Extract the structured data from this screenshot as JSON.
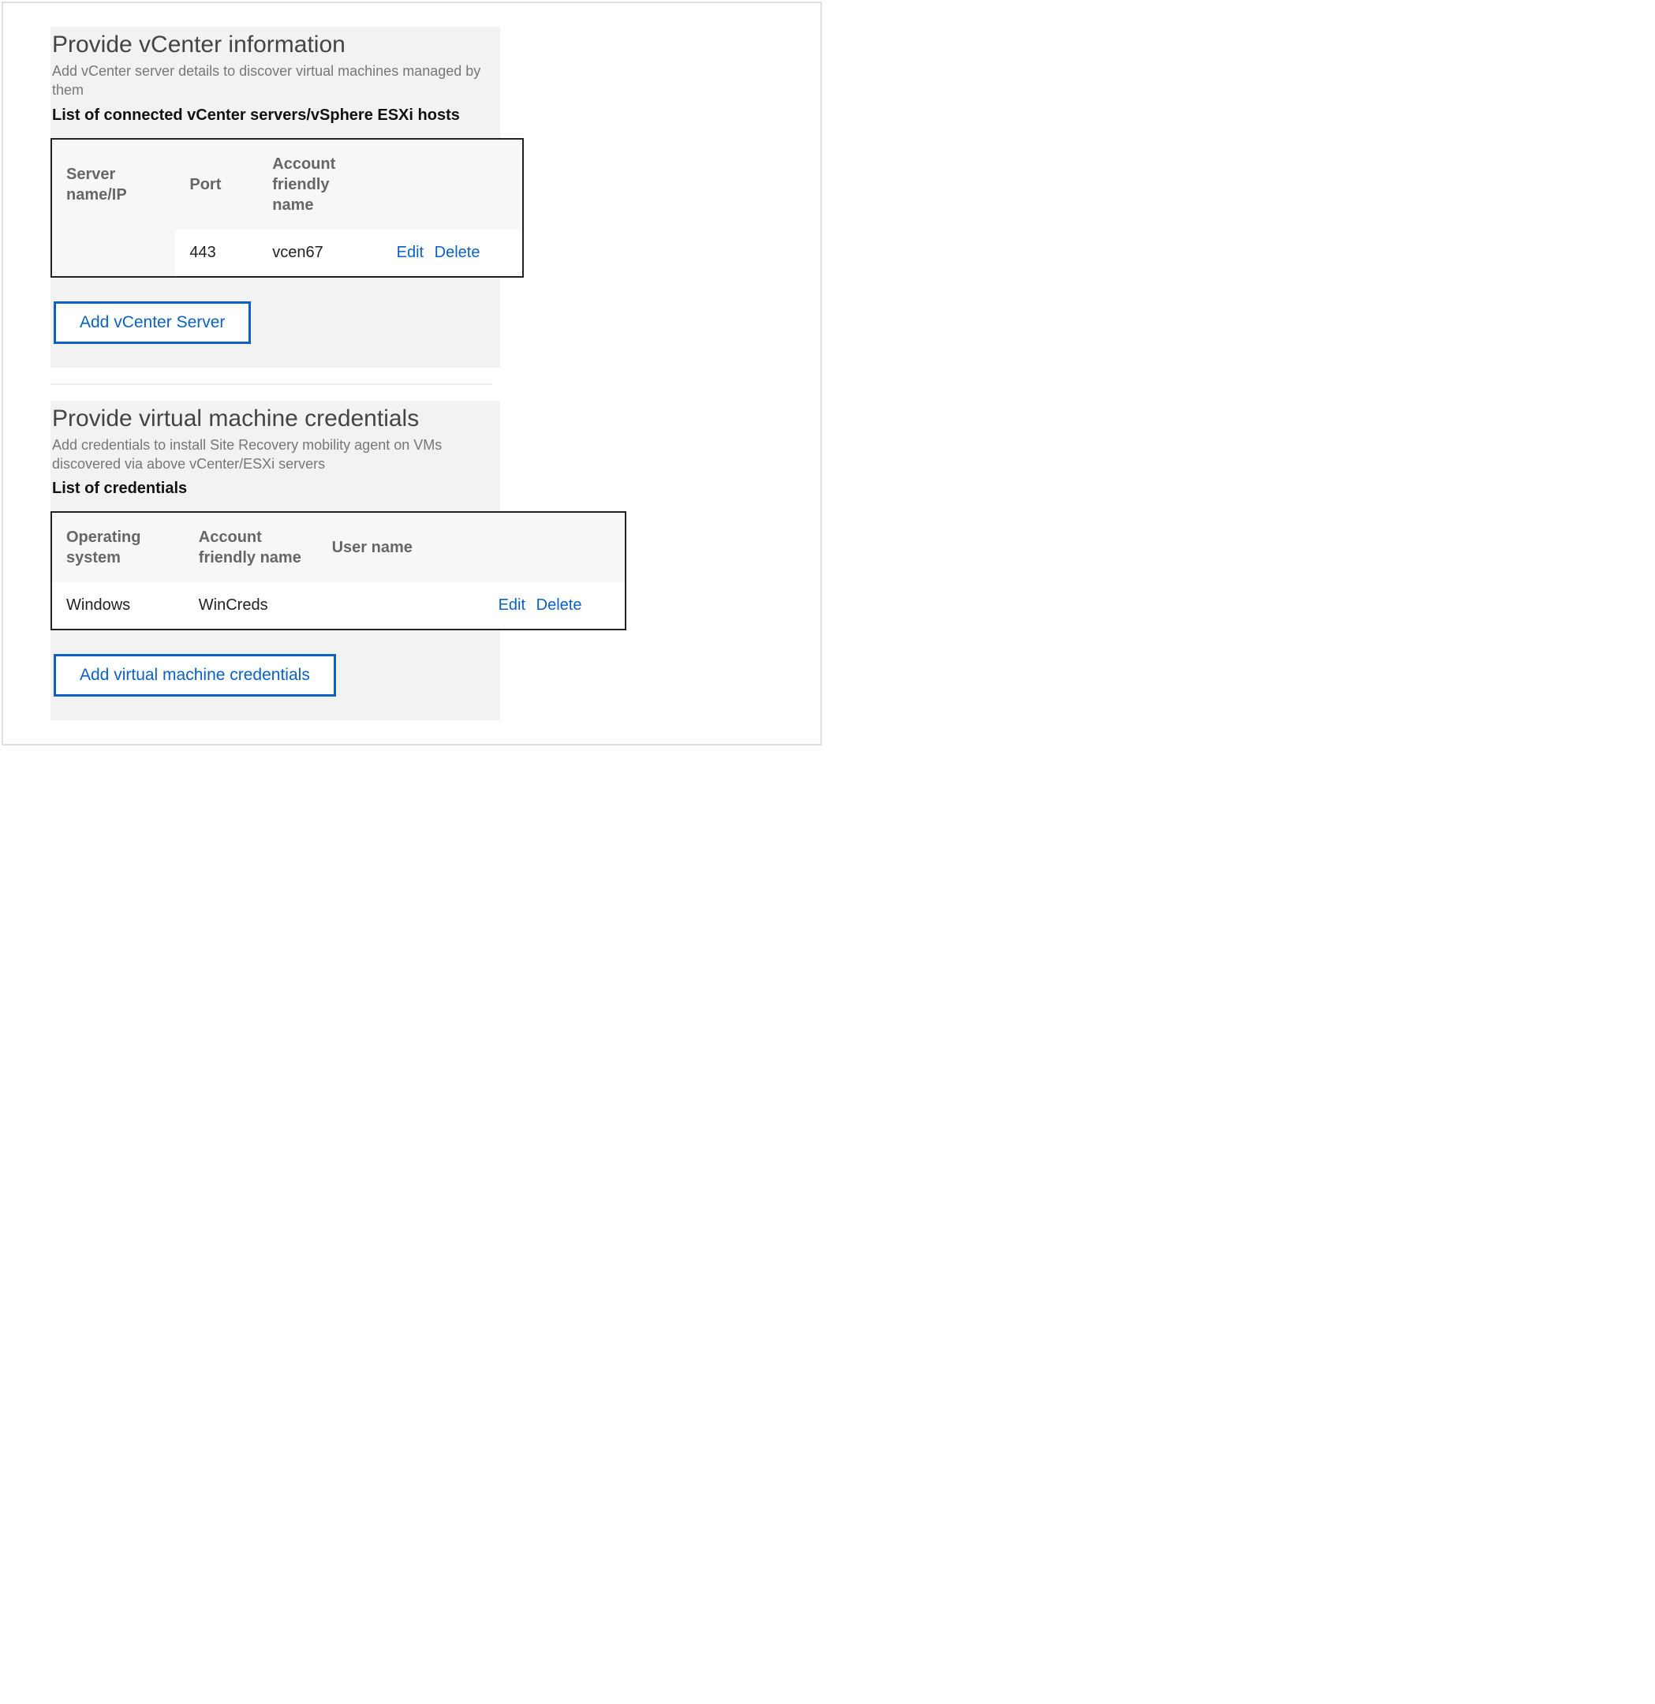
{
  "vcenter": {
    "title": "Provide vCenter information",
    "desc": "Add vCenter server details to discover virtual machines managed by them",
    "list_label": "List of connected vCenter servers/vSphere ESXi hosts",
    "headers": {
      "server": "Server name/IP",
      "port": "Port",
      "account": "Account friendly name",
      "actions": ""
    },
    "row": {
      "server": "",
      "port": "443",
      "account": "vcen67",
      "edit": "Edit",
      "delete": "Delete"
    },
    "add_button": "Add vCenter Server"
  },
  "vmcred": {
    "title": "Provide virtual machine credentials",
    "desc": "Add credentials to install Site Recovery mobility agent on VMs discovered via above vCenter/ESXi servers",
    "list_label": "List of credentials",
    "headers": {
      "os": "Operating system",
      "account": "Account friendly name",
      "user": "User name",
      "actions": ""
    },
    "row": {
      "os": "Windows",
      "account": "WinCreds",
      "user": "",
      "edit": "Edit",
      "delete": "Delete"
    },
    "add_button": "Add virtual machine credentials"
  }
}
